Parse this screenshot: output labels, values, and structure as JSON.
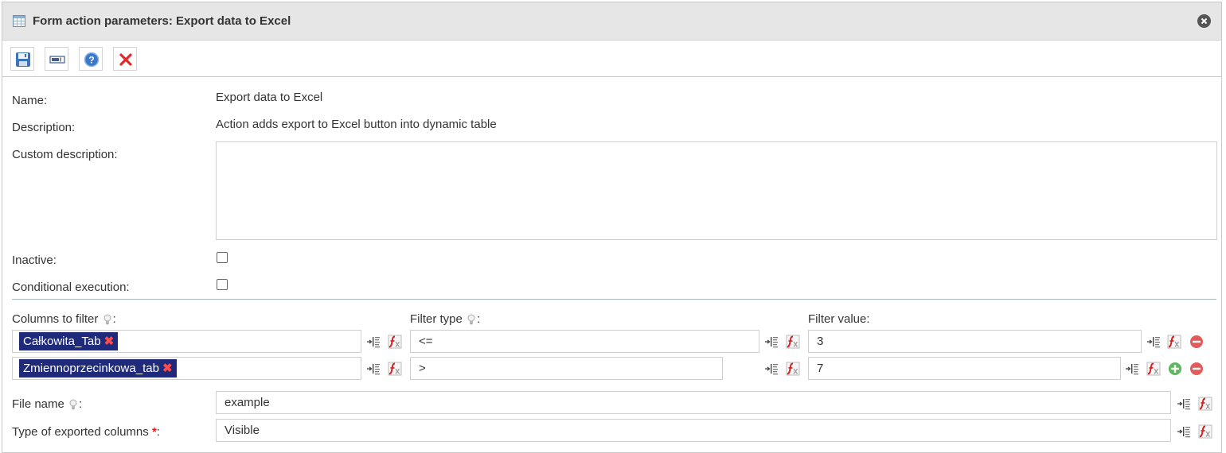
{
  "dialog": {
    "title": "Form action parameters: Export data to Excel"
  },
  "icons": {
    "title": "table-icon",
    "close": "close-circle-icon",
    "save": "floppy-disk-icon",
    "rename": "textbox-icon",
    "help": "help-icon",
    "delete": "delete-x-icon",
    "variable": "insert-variable-icon",
    "expression": "function-icon",
    "hint": "lightbulb-icon",
    "remove_row": "minus-circle-icon",
    "add_row": "plus-circle-icon"
  },
  "form": {
    "name_label": "Name:",
    "name_value": "Export data to Excel",
    "description_label": "Description:",
    "description_value": "Action adds export to Excel button into dynamic table",
    "custom_description_label": "Custom description:",
    "custom_description_value": "",
    "inactive_label": "Inactive:",
    "conditional_label": "Conditional execution:",
    "columns_label": "Columns to filter",
    "filter_type_label": "Filter type",
    "filter_value_label": "Filter value:",
    "colon": ":",
    "rows": [
      {
        "column": "Całkowita_Tab",
        "remove": "✖",
        "filter_type": "<=",
        "filter_value": "3"
      },
      {
        "column": "Zmiennoprzecinkowa_tab",
        "remove": "✖",
        "filter_type": ">",
        "filter_value": "7"
      }
    ],
    "file_name_label": "File name",
    "file_name_value": "example",
    "exported_columns_label": "Type of exported columns",
    "required_mark": "*",
    "exported_columns_value": "Visible"
  },
  "colors": {
    "tag_bg": "#1f2a7a",
    "remove_x": "#ff4b4b",
    "required": "#e01a1a"
  }
}
